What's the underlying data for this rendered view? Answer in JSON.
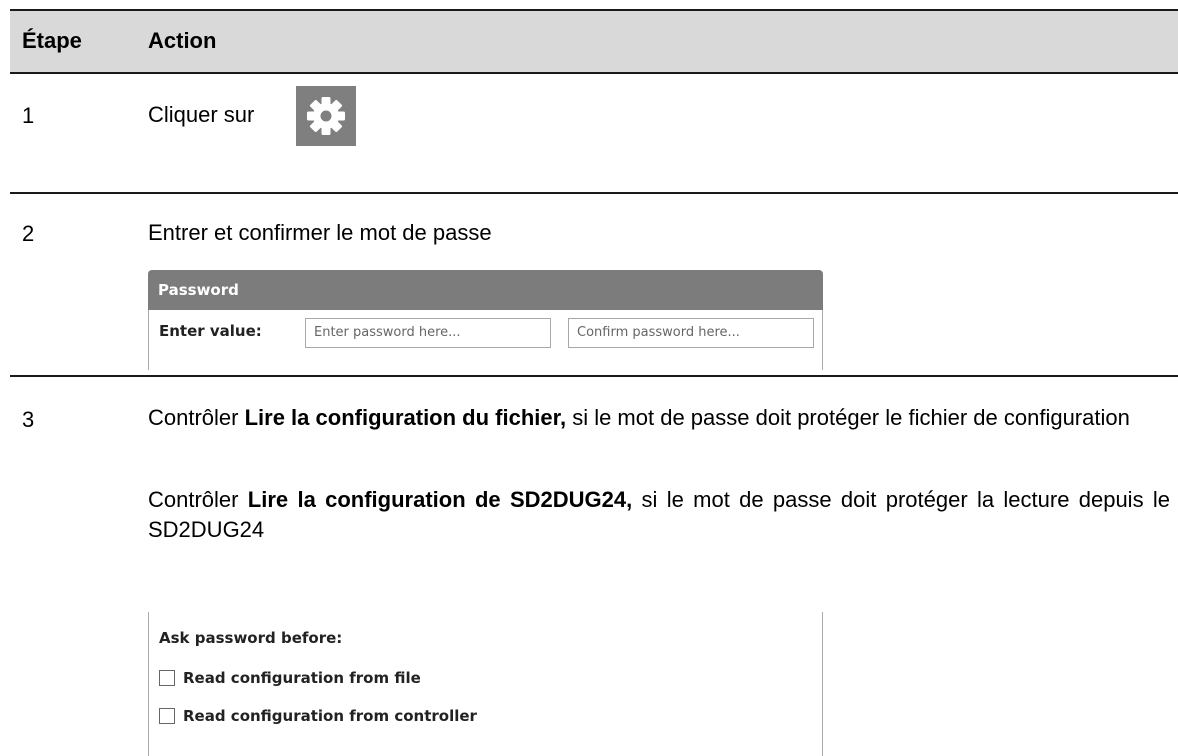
{
  "table": {
    "header": {
      "step": "Étape",
      "action": "Action"
    },
    "rows": [
      {
        "num": "1",
        "text": "Cliquer sur"
      },
      {
        "num": "2",
        "text": "Entrer et confirmer le mot de passe"
      },
      {
        "num": "3",
        "para1": {
          "pre": "Contrôler ",
          "bold": "Lire la configuration du fichier,",
          "post": " si le mot de passe doit protéger le fichier de configuration"
        },
        "para2": {
          "pre": "Contrôler ",
          "bold": "Lire la configuration de SD2DUG24,",
          "post": " si le mot de passe doit protéger la lecture depuis le SD2DUG24"
        }
      }
    ]
  },
  "settings_button": {
    "icon": "gear-icon"
  },
  "password_panel": {
    "title": "Password",
    "label": "Enter value:",
    "input1_placeholder": "Enter password here...",
    "input2_placeholder": "Confirm password here..."
  },
  "ask_panel": {
    "title": "Ask password before:",
    "options": [
      {
        "label": "Read configuration from file",
        "checked": false
      },
      {
        "label": "Read configuration from controller",
        "checked": false
      }
    ]
  }
}
